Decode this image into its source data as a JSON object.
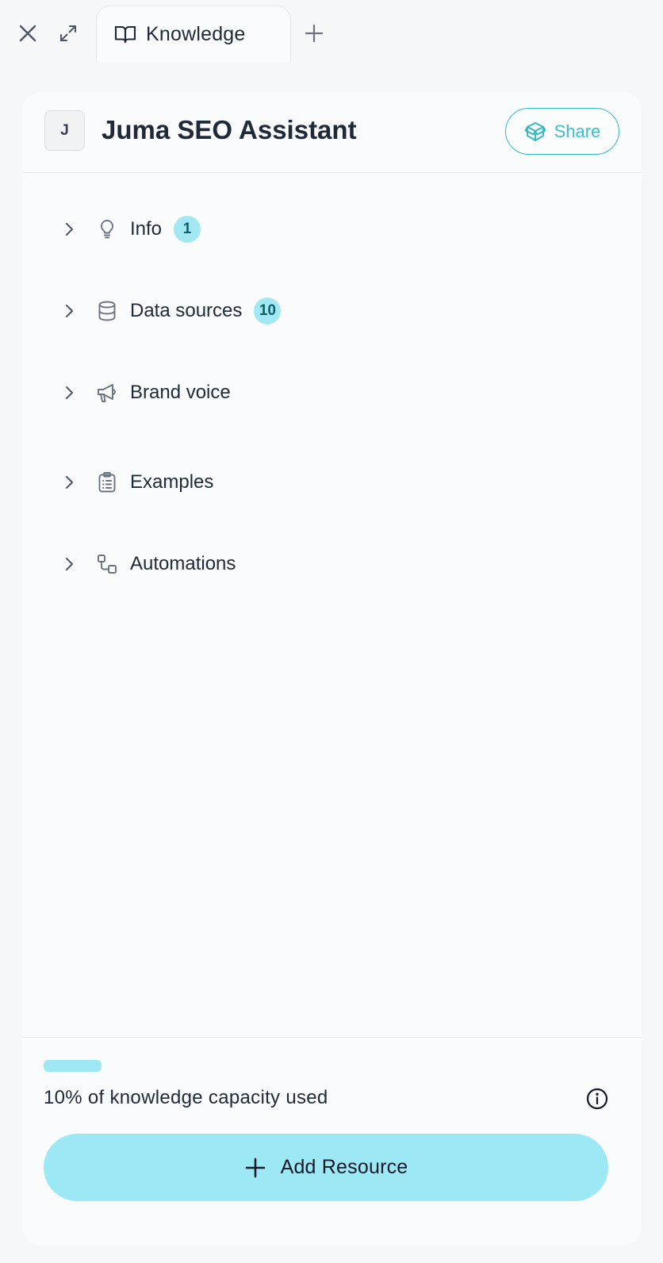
{
  "tabbar": {
    "close_icon": "close-icon",
    "expand_icon": "expand-icon",
    "active_tab": {
      "label": "Knowledge",
      "icon": "book-open-icon"
    },
    "add_tab_icon": "plus-icon"
  },
  "header": {
    "avatar_letter": "J",
    "title": "Juma SEO Assistant",
    "share_label": "Share",
    "share_icon": "box-icon"
  },
  "sections": [
    {
      "label": "Info",
      "icon": "lightbulb-icon",
      "badge": "1"
    },
    {
      "label": "Data sources",
      "icon": "database-icon",
      "badge": "10"
    },
    {
      "label": "Brand voice",
      "icon": "megaphone-icon",
      "badge": null
    },
    {
      "label": "Examples",
      "icon": "clipboard-list-icon",
      "badge": null
    },
    {
      "label": "Automations",
      "icon": "workflow-icon",
      "badge": null
    }
  ],
  "footer": {
    "capacity_used_fraction": 0.1,
    "capacity_text": "10% of knowledge capacity used",
    "info_icon": "info-icon",
    "add_resource_label": "Add Resource",
    "add_resource_icon": "plus-icon"
  },
  "colors": {
    "accent": "#9ce9f5",
    "share_accent": "#32b8c6",
    "badge_bg": "#a1e8f3",
    "text": "#1f2937"
  }
}
